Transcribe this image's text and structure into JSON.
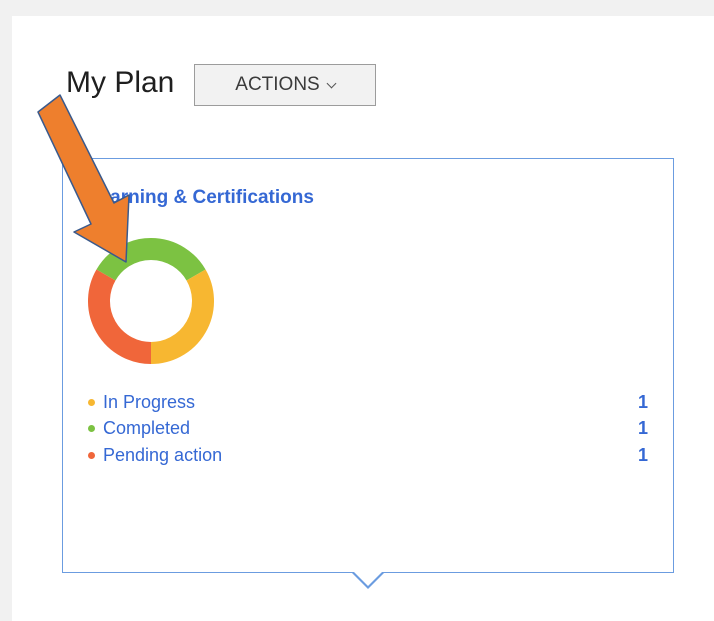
{
  "header": {
    "title": "My Plan",
    "actions_label": "ACTIONS"
  },
  "card": {
    "title": "Learning & Certifications",
    "chart_data": {
      "type": "pie",
      "variant": "donut",
      "categories": [
        "In Progress",
        "Completed",
        "Pending action"
      ],
      "values": [
        1,
        1,
        1
      ],
      "colors": [
        "#f7b731",
        "#7cc242",
        "#f0663a"
      ]
    },
    "legend": [
      {
        "label": "In Progress",
        "count": "1",
        "color": "#f7b731"
      },
      {
        "label": "Completed",
        "count": "1",
        "color": "#7cc242"
      },
      {
        "label": "Pending action",
        "count": "1",
        "color": "#f0663a"
      }
    ]
  },
  "colors": {
    "accent": "#3568d4",
    "card_border": "#6b9ce0",
    "annotation_arrow": "#ee7f2d"
  }
}
